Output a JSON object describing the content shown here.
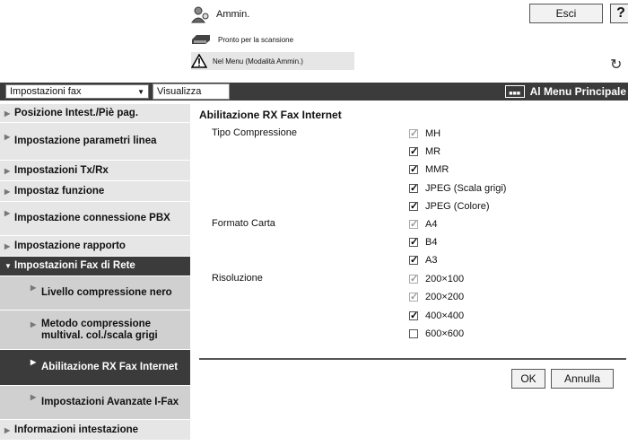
{
  "header": {
    "user_label": "Ammin.",
    "logout_label": "Esci",
    "help_label": "?",
    "status_scan": "Pronto per la scansione",
    "status_menu": "Nel Menu (Modalità Ammin.)"
  },
  "toolbar": {
    "category_value": "Impostazioni fax",
    "view_label": "Visualizza",
    "main_menu_label": "Al Menu Principale"
  },
  "sidebar": {
    "items": [
      {
        "label": "Posizione Intest./Piè pag."
      },
      {
        "label": "Impostazione parametri linea"
      },
      {
        "label": "Impostazioni Tx/Rx"
      },
      {
        "label": "Impostaz funzione"
      },
      {
        "label": "Impostazione connessione PBX"
      },
      {
        "label": "Impostazione rapporto"
      },
      {
        "label": "Impostazioni Fax di Rete"
      },
      {
        "label": "Livello compressione nero"
      },
      {
        "label": "Metodo compressione multival. col./scala grigi"
      },
      {
        "label": "Abilitazione RX Fax Internet"
      },
      {
        "label": "Impostazioni Avanzate I-Fax"
      },
      {
        "label": "Informazioni intestazione"
      }
    ]
  },
  "main": {
    "title": "Abilitazione RX Fax Internet",
    "compression_label": "Tipo Compressione",
    "compression_options": [
      "MH",
      "MR",
      "MMR",
      "JPEG (Scala grigi)",
      "JPEG (Colore)"
    ],
    "paper_label": "Formato Carta",
    "paper_options": [
      "A4",
      "B4",
      "A3"
    ],
    "resolution_label": "Risoluzione",
    "resolution_options": [
      "200×100",
      "200×200",
      "400×400",
      "600×600"
    ],
    "ok_label": "OK",
    "cancel_label": "Annulla"
  }
}
